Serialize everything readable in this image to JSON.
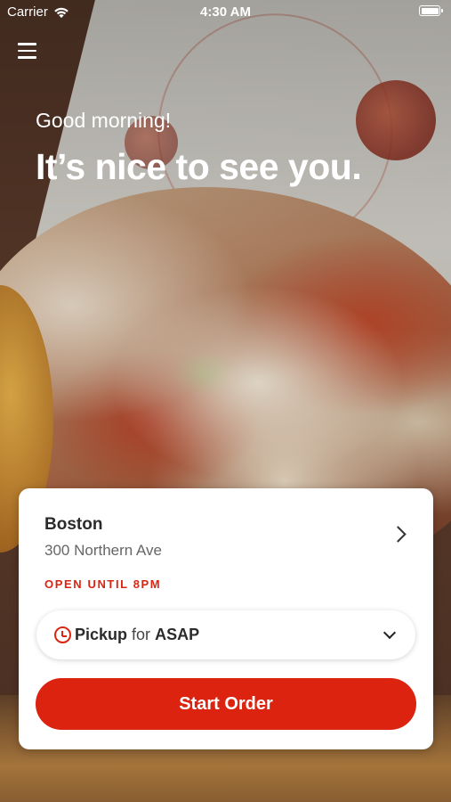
{
  "status_bar": {
    "carrier": "Carrier",
    "time": "4:30 AM",
    "wifi_icon": "wifi-icon",
    "battery_icon": "battery-icon",
    "battery_level": 1.0
  },
  "header": {
    "menu_icon": "menu-icon",
    "greeting": "Good morning!",
    "headline": "It’s nice to see you."
  },
  "location_card": {
    "city": "Boston",
    "address": "300 Northern Ave",
    "hours": "OPEN UNTIL 8PM",
    "chevron_icon": "chevron-right-icon",
    "order_mode": {
      "icon": "clock-icon",
      "method": "Pickup",
      "connector": "for",
      "timing": "ASAP",
      "dropdown_icon": "chevron-down-icon"
    },
    "start_order_label": "Start Order"
  },
  "colors": {
    "accent": "#db2310",
    "hours_text": "#d92612",
    "card_bg": "#ffffff",
    "text_primary": "#2b2b2b",
    "text_secondary": "#666666"
  }
}
